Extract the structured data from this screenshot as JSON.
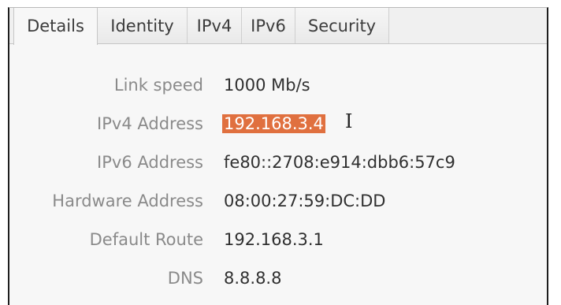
{
  "tabs": [
    {
      "label": "Details",
      "active": true
    },
    {
      "label": "Identity",
      "active": false
    },
    {
      "label": "IPv4",
      "active": false
    },
    {
      "label": "IPv6",
      "active": false
    },
    {
      "label": "Security",
      "active": false
    }
  ],
  "details": [
    {
      "label": "Link speed",
      "value": "1000 Mb/s"
    },
    {
      "label": "IPv4 Address",
      "value": "192.168.3.4",
      "selected": true
    },
    {
      "label": "IPv6 Address",
      "value": "fe80::2708:e914:dbb6:57c9"
    },
    {
      "label": "Hardware Address",
      "value": "08:00:27:59:DC:DD"
    },
    {
      "label": "Default Route",
      "value": "192.168.3.1"
    },
    {
      "label": "DNS",
      "value": "8.8.8.8"
    }
  ],
  "colors": {
    "selection": "#e0703f",
    "label_text": "#8a8a8a",
    "value_text": "#303030"
  },
  "icons": {
    "pointer": "text-cursor-icon"
  }
}
